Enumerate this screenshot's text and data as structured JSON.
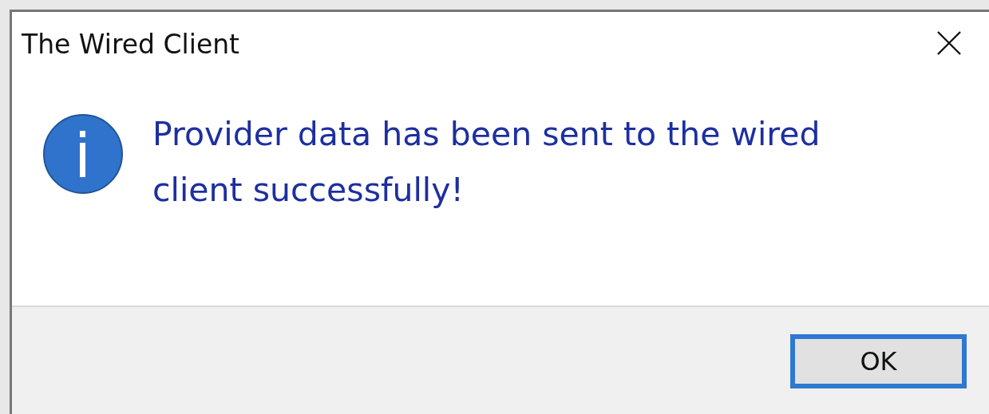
{
  "window": {
    "title": "The Wired Client"
  },
  "message": {
    "kind": "info",
    "text": "Provider data has been sent to the wired client successfully!"
  },
  "buttons": [
    {
      "label": "OK",
      "selected": true
    }
  ]
}
